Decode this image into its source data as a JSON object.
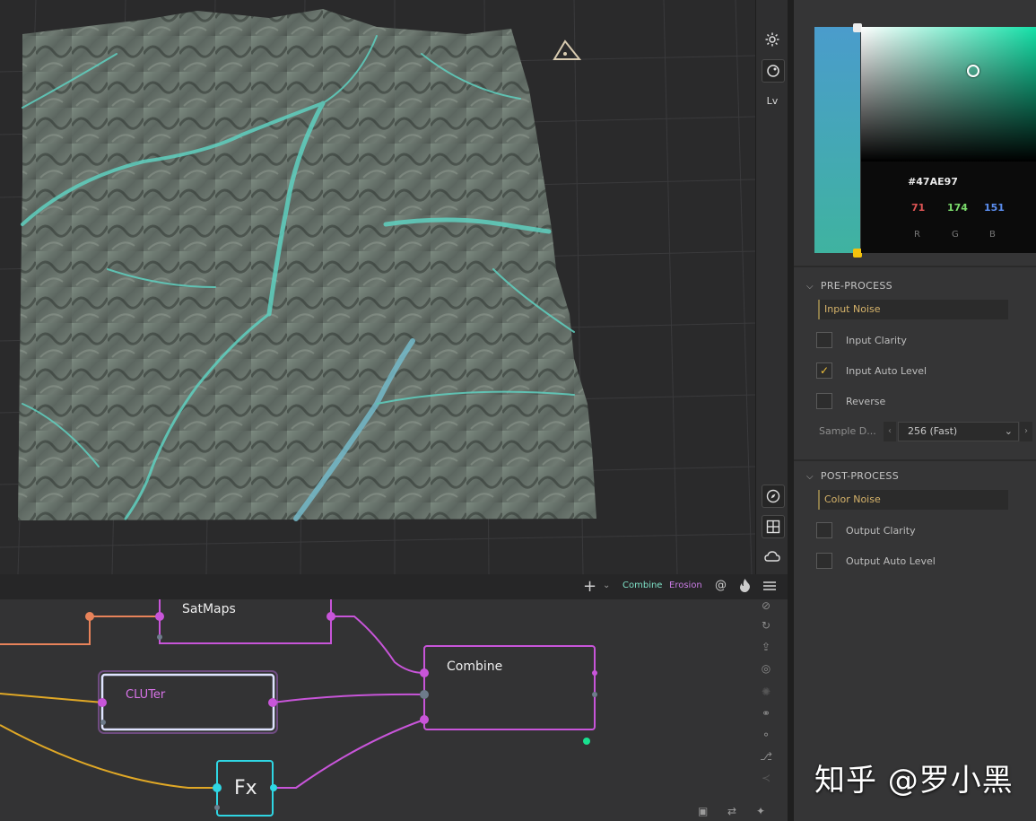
{
  "viewport": {
    "toolbar": {
      "sun_icon": "sun-icon",
      "sphere_icon": "sphere-icon",
      "lv_label": "Lv",
      "compass_icon": "compass-icon",
      "grid_icon": "grid-icon",
      "cloud_icon": "cloud-icon"
    }
  },
  "color_picker": {
    "hex": "#47AE97",
    "r": "71",
    "g": "174",
    "b": "151",
    "r_label": "R",
    "g_label": "G",
    "b_label": "B",
    "colors": {
      "r": "#e05555",
      "g": "#7bdc6c",
      "b": "#5b8ef0"
    }
  },
  "pre_process": {
    "title": "PRE-PROCESS",
    "noise_field": "Input Noise",
    "clarity": {
      "label": "Input Clarity",
      "checked": false
    },
    "auto_level": {
      "label": "Input Auto Level",
      "checked": true
    },
    "reverse": {
      "label": "Reverse",
      "checked": false
    },
    "sample_label": "Sample D...",
    "sample_value": "256 (Fast)"
  },
  "post_process": {
    "title": "POST-PROCESS",
    "noise_field": "Color Noise",
    "clarity": {
      "label": "Output Clarity",
      "checked": false
    },
    "auto_level": {
      "label": "Output Auto Level",
      "checked": false
    }
  },
  "graph_toolbar": {
    "add_label": "+",
    "combine_tag": "Combine",
    "erosion_tag": "Erosion",
    "combine_color": "#7fe3c9",
    "erosion_color": "#c87be3"
  },
  "nodes": {
    "satmaps": "SatMaps",
    "cluter": "CLUTer",
    "combine": "Combine",
    "fx": "Fx"
  },
  "watermark": "知乎 @罗小黑"
}
